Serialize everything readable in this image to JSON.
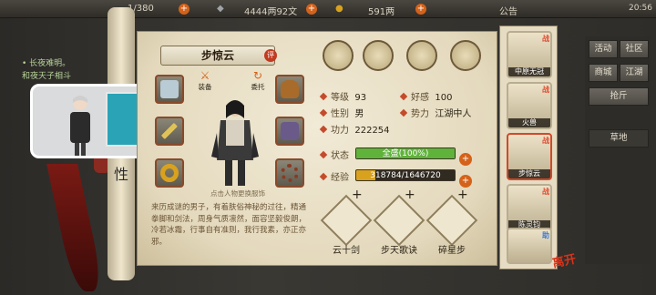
{
  "topbar": {
    "gems": "1/380",
    "silver": "4444两92文",
    "gold": "591两",
    "announce": "公告",
    "time": "20:56"
  },
  "backdrop": {
    "line1": "• 长夜难明。",
    "line2": "和夜天子相斗"
  },
  "rod_glyph": "性",
  "hero": {
    "name": "步惊云",
    "comment_btn": "评",
    "change_hint": "点击人物更换服饰"
  },
  "action_icons": [
    {
      "label": "装备",
      "name": "equip-icon"
    },
    {
      "label": "委托",
      "name": "delegate-icon"
    }
  ],
  "stats": {
    "level_label": "等级",
    "level": "93",
    "favor_label": "好感",
    "favor": "100",
    "gender_label": "性别",
    "gender": "男",
    "faction_label": "势力",
    "faction": "江湖中人",
    "power_label": "功力",
    "power": "222254"
  },
  "status": {
    "label": "状态",
    "value": "全盛(100%)",
    "fill": 1.0,
    "color": "#5fb33a"
  },
  "exp": {
    "label": "经验",
    "value": "318784/1646720",
    "fill": 0.1936,
    "color": "#d9a21e"
  },
  "bio": "来历成谜的男子，有着肤俗神秘的过往，精通拳脚和剑法，周身气质凛然，面容坚毅俊朗，冷若冰霜，行事自有准则，我行我素，亦正亦邪。",
  "skills": [
    {
      "label": "云十剑"
    },
    {
      "label": "步天歌诀"
    },
    {
      "label": "碎星步"
    }
  ],
  "roster": [
    {
      "label": "中原无冠",
      "tag": "战"
    },
    {
      "label": "火兽",
      "tag": "战"
    },
    {
      "label": "步惊云",
      "tag": "战"
    },
    {
      "label": "陈灵钧",
      "tag": "战"
    },
    {
      "label": "",
      "tag": "助"
    }
  ],
  "menu": {
    "btn1": "活动",
    "btn2": "社区",
    "btn3": "商城",
    "btn4": "江湖",
    "btn5": "抢斤",
    "map": "草地"
  },
  "close_label": "离开",
  "colors": {
    "accent": "#d4621a",
    "paper": "#e9e0c8",
    "frame": "#8a4a2a"
  }
}
